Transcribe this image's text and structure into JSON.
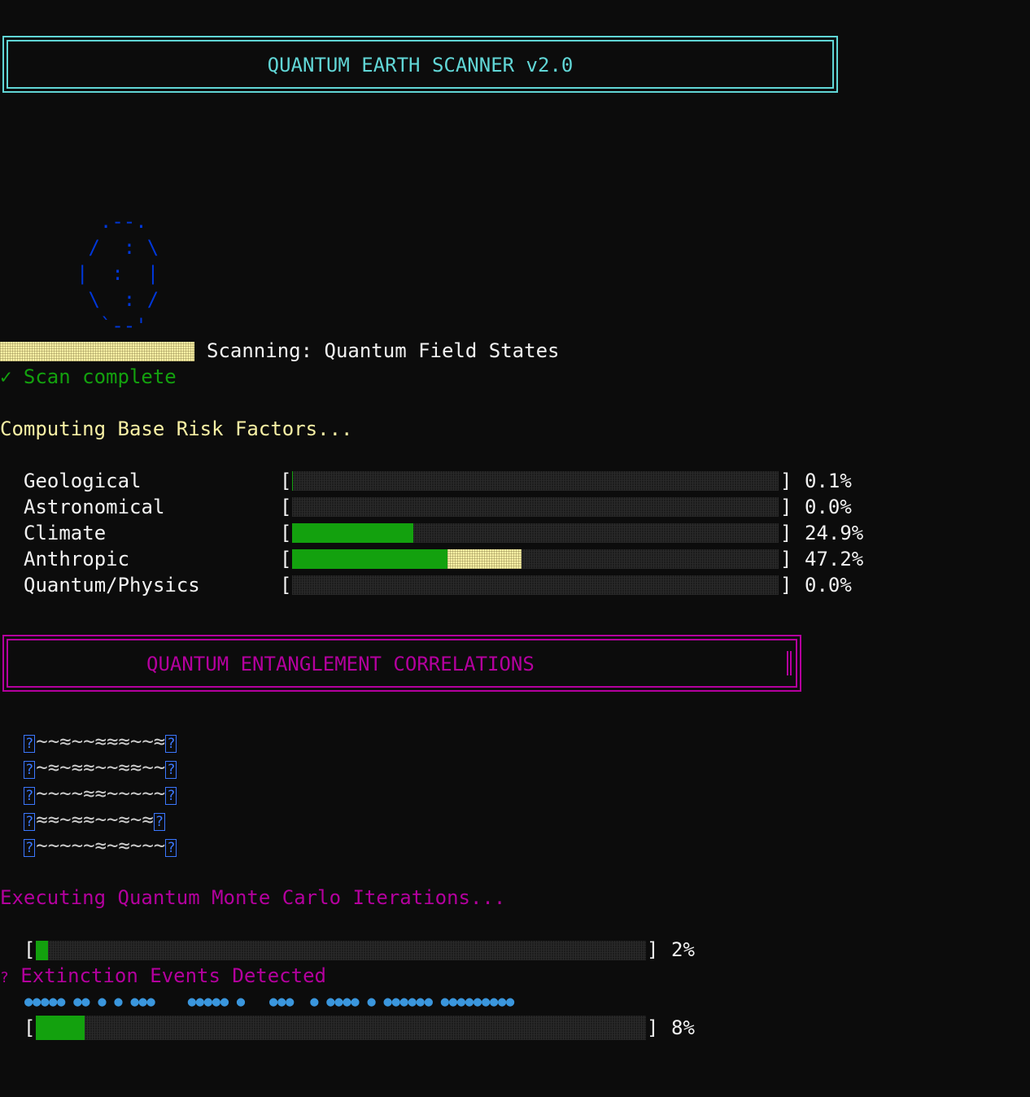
{
  "header": {
    "title": "QUANTUM EARTH SCANNER v2.0"
  },
  "earth_art": {
    "lines": [
      "  .--.",
      " /  : \\",
      "|  :  |",
      " \\  : /",
      "  `--'"
    ]
  },
  "scan": {
    "status_label": "Scanning: Quantum Field States",
    "progress": 1.0,
    "complete_icon": "✓",
    "complete_label": "Scan complete"
  },
  "risk": {
    "heading": "Computing Base Risk Factors...",
    "rows": [
      {
        "label": "Geological",
        "value": "0.1%",
        "green": 0.001,
        "light": 0.0
      },
      {
        "label": "Astronomical",
        "value": "0.0%",
        "green": 0.0,
        "light": 0.0
      },
      {
        "label": "Climate",
        "value": "24.9%",
        "green": 0.249,
        "light": 0.0
      },
      {
        "label": "Anthropic",
        "value": "47.2%",
        "green": 0.32,
        "light": 0.152
      },
      {
        "label": "Quantum/Physics",
        "value": "0.0%",
        "green": 0.0,
        "light": 0.0
      }
    ]
  },
  "entanglement": {
    "title": "QUANTUM ENTANGLEMENT CORRELATIONS",
    "rows": [
      "?~~≈~~≈≈≈~~≈?",
      "?~≈~≈≈~~≈≈~~?",
      "?~~~~≈≈~~~~~?",
      "?≈≈~≈≈~~≈~≈?",
      "?~~~~~≈~≈~~~?"
    ]
  },
  "monte_carlo": {
    "heading": "Executing Quantum Monte Carlo Iterations...",
    "bar1": {
      "value": "2%",
      "fraction": 0.02
    },
    "extinction_icon": "?",
    "extinction_label": "Extinction Events Detected",
    "events_dots": "●●●●● ●● ● ● ●●●    ●●●●● ●   ●●●  ● ●●●● ● ●●●●●● ●●●●●●●●●",
    "bar2": {
      "value": "8%",
      "fraction": 0.08
    }
  },
  "colors": {
    "background": "#0c0c0c",
    "cyan": "#61d6d6",
    "magenta": "#b4009e",
    "green": "#13a10e",
    "light_yellow": "#f9f1a5",
    "blue": "#0037da",
    "dot_blue": "#3a96dd"
  }
}
